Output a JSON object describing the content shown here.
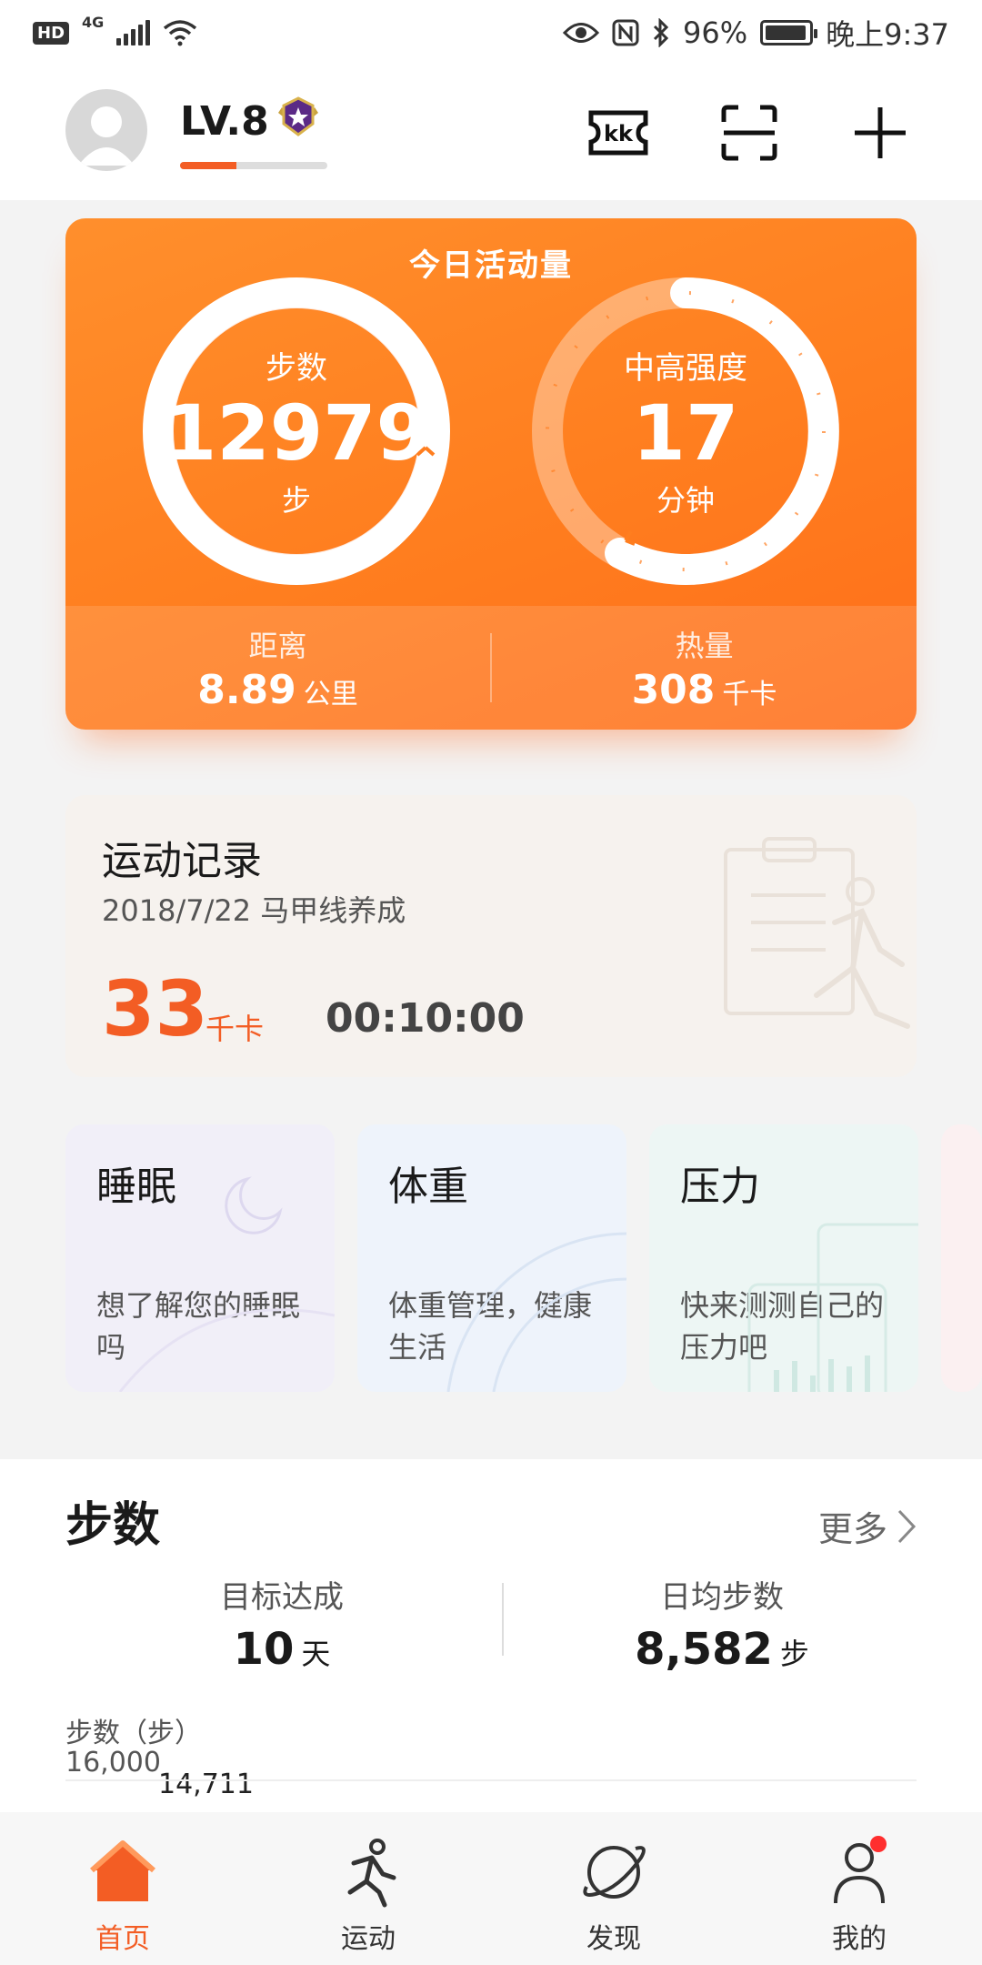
{
  "status_bar": {
    "hd": "HD",
    "network": "4G",
    "battery": "96%",
    "battery_level": 0.96,
    "time": "晚上9:37"
  },
  "header": {
    "level": "LV.8",
    "level_progress": 0.38,
    "icons": [
      "ticket-kk-icon",
      "scan-icon",
      "add-icon"
    ]
  },
  "activity": {
    "title": "今日活动量",
    "steps": {
      "label": "步数",
      "value": "12979",
      "unit": "步"
    },
    "intensity": {
      "label": "中高强度",
      "value": "17",
      "unit": "分钟"
    },
    "distance": {
      "label": "距离",
      "value": "8.89",
      "unit": "公里"
    },
    "calories": {
      "label": "热量",
      "value": "308",
      "unit": "千卡"
    }
  },
  "record": {
    "title": "运动记录",
    "subtitle": "2018/7/22  马甲线养成",
    "kcal": "33",
    "kcal_unit": "千卡",
    "duration": "00:10:00"
  },
  "cards": [
    {
      "title": "睡眠",
      "desc": "想了解您的睡眠吗"
    },
    {
      "title": "体重",
      "desc": "体重管理，健康生活"
    },
    {
      "title": "压力",
      "desc": "快来测测自己的压力吧"
    }
  ],
  "steps_section": {
    "title": "步数",
    "more": "更多",
    "goal_label": "目标达成",
    "goal_value": "10",
    "goal_unit": "天",
    "avg_label": "日均步数",
    "avg_value": "8,582",
    "avg_unit": "步",
    "chart_label": "步数（步）",
    "chart_ymax": "16,000",
    "chart_peak": "14,711"
  },
  "nav": [
    {
      "label": "首页",
      "active": true
    },
    {
      "label": "运动",
      "active": false
    },
    {
      "label": "发现",
      "active": false
    },
    {
      "label": "我的",
      "active": false
    }
  ],
  "colors": {
    "accent": "#f35d24",
    "card_orange": "#ff7e1f"
  }
}
